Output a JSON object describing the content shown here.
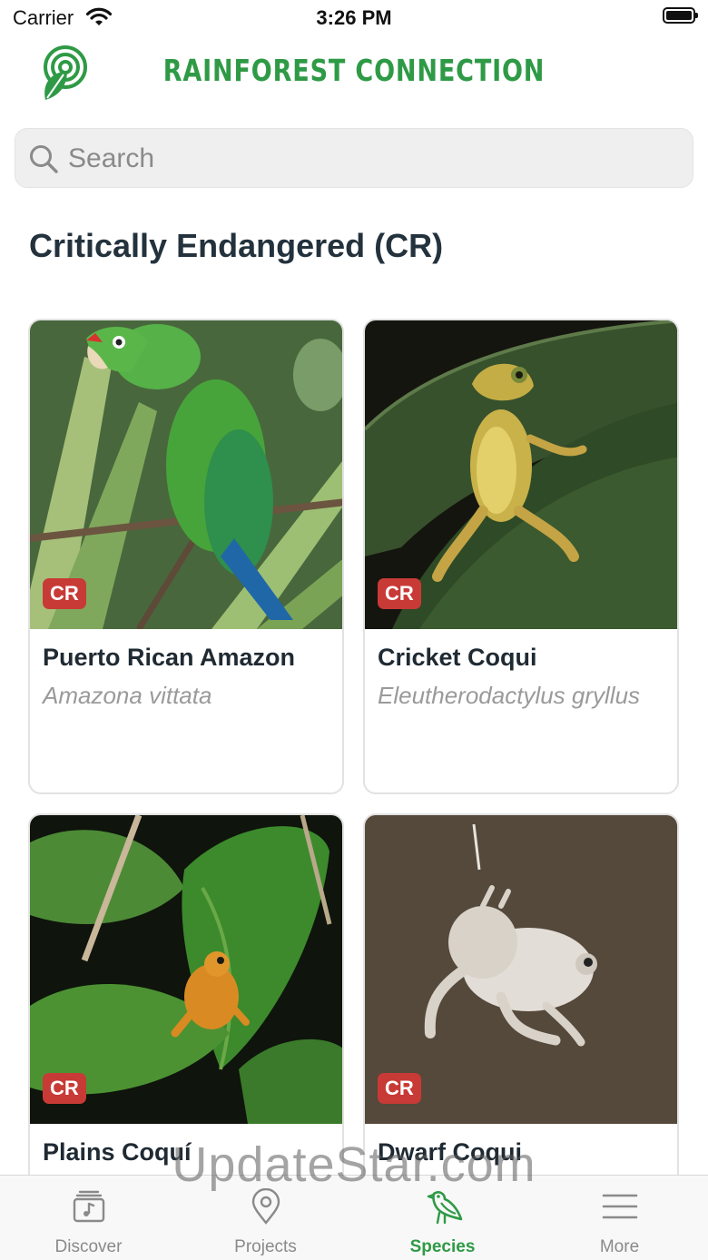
{
  "status_bar": {
    "carrier": "Carrier",
    "time": "3:26 PM"
  },
  "header": {
    "brand": "RAINFOREST CONNECTION",
    "logo_icon": "rainforest-connection-logo-icon"
  },
  "search": {
    "placeholder": "Search",
    "value": ""
  },
  "section": {
    "title": "Critically Endangered (CR)"
  },
  "species": [
    {
      "badge": "CR",
      "common_name": "Puerto Rican Amazon",
      "scientific_name": "Amazona vittata"
    },
    {
      "badge": "CR",
      "common_name": "Cricket Coqui",
      "scientific_name": "Eleutherodactylus gryllus"
    },
    {
      "badge": "CR",
      "common_name": "Plains Coquí",
      "scientific_name": ""
    },
    {
      "badge": "CR",
      "common_name": "Dwarf Coqui",
      "scientific_name": ""
    }
  ],
  "tabs": [
    {
      "label": "Discover",
      "icon": "discover-icon",
      "active": false
    },
    {
      "label": "Projects",
      "icon": "map-pin-icon",
      "active": false
    },
    {
      "label": "Species",
      "icon": "bird-icon",
      "active": true
    },
    {
      "label": "More",
      "icon": "menu-icon",
      "active": false
    }
  ],
  "watermark": "UpdateStar.com",
  "colors": {
    "brand_green": "#2f9a46",
    "badge_red": "#c83a36",
    "text_dark": "#1f2a33",
    "text_muted": "#9a9a9a"
  }
}
